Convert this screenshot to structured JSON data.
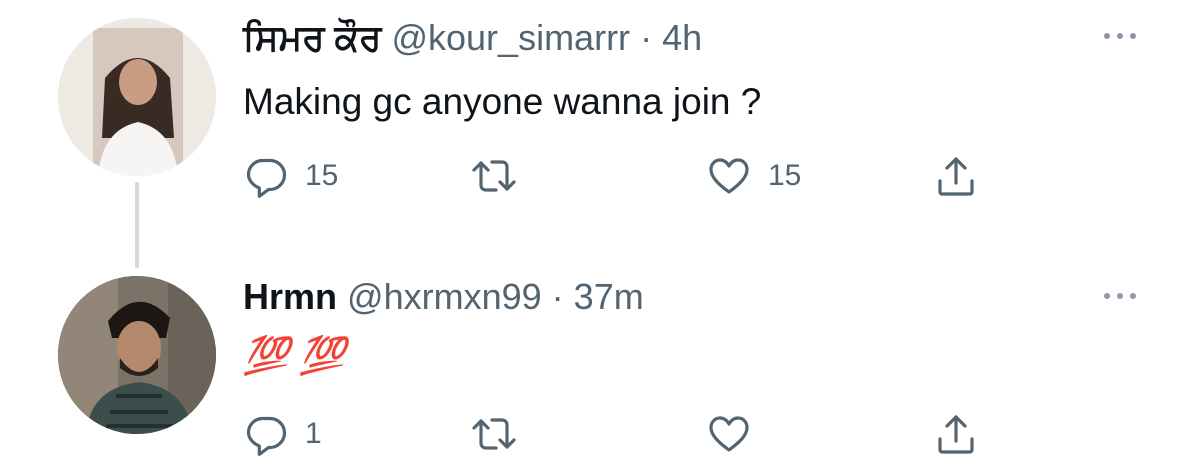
{
  "tweets": [
    {
      "display_name": "ਸਿਮਰ ਕੌਰ",
      "handle": "@kour_simarrr",
      "separator": "·",
      "time": "4h",
      "text": "Making gc anyone wanna join ?",
      "reply_count": "15",
      "retweet_count": "",
      "like_count": "15"
    },
    {
      "display_name": "Hrmn",
      "handle": "@hxrmxn99",
      "separator": "·",
      "time": "37m",
      "text": "💯 💯",
      "reply_count": "1",
      "retweet_count": "",
      "like_count": ""
    }
  ],
  "icons": {
    "reply": "reply-icon",
    "retweet": "retweet-icon",
    "like": "heart-icon",
    "share": "share-icon",
    "more": "more-icon"
  },
  "colors": {
    "primary_text": "#0f1419",
    "secondary_text": "#536471",
    "thread_line": "#cfd9de",
    "emoji_red": "#d7262c"
  }
}
